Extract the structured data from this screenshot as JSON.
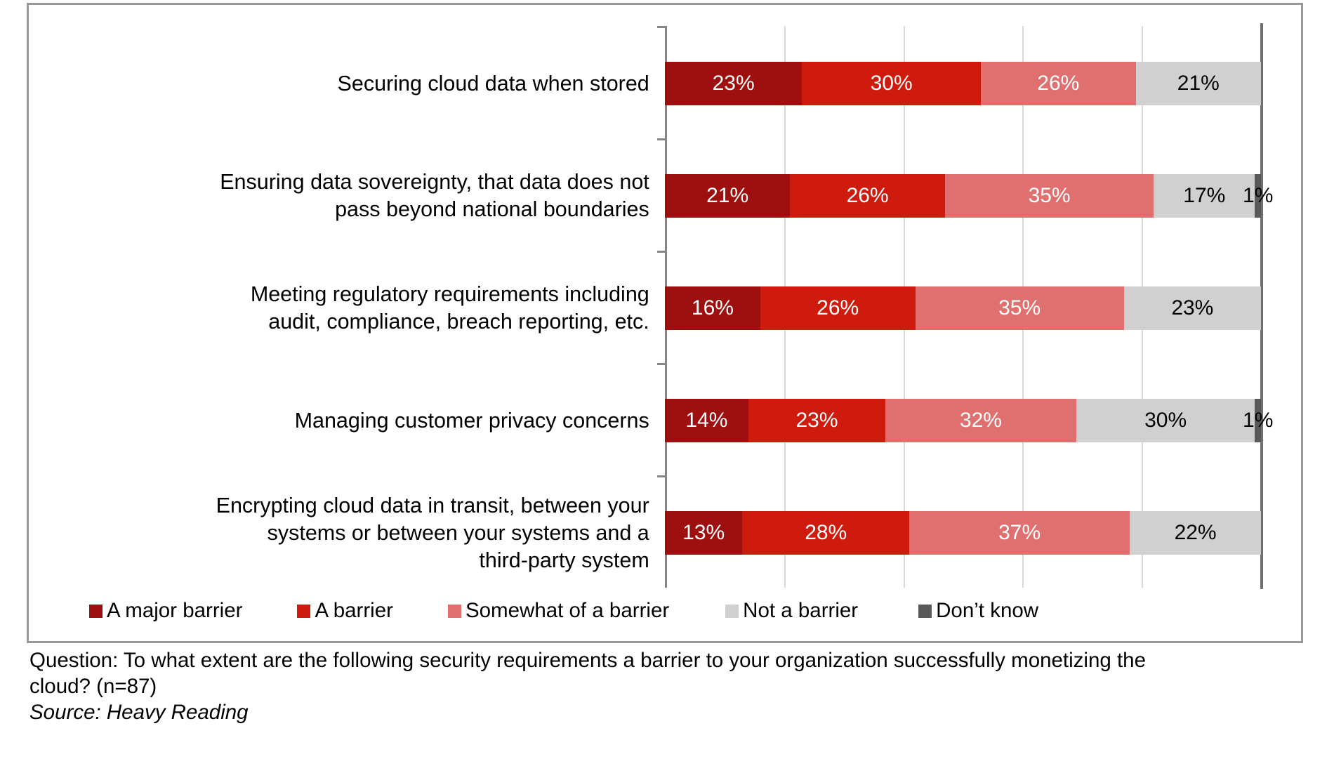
{
  "chart_data": {
    "type": "bar",
    "subtype": "100% stacked horizontal bar",
    "title": "",
    "xlabel": "",
    "ylabel": "",
    "xlim": [
      0,
      100
    ],
    "grid": true,
    "gridline_values": [
      0,
      20,
      40,
      60,
      80,
      100
    ],
    "legend_position": "bottom",
    "value_suffix": "%",
    "categories": [
      "Securing cloud data when stored",
      "Ensuring data sovereignty, that data does not\npass beyond national boundaries",
      "Meeting regulatory requirements including\naudit, compliance, breach reporting, etc.",
      "Managing customer privacy concerns",
      "Encrypting cloud data in transit, between your\nsystems or between your systems and a\nthird-party system"
    ],
    "series": [
      {
        "name": "A major barrier",
        "color": "#9E1010",
        "label_color": "#FFFFFF",
        "values": [
          23,
          21,
          16,
          14,
          13
        ],
        "labels": [
          "23%",
          "21%",
          "16%",
          "14%",
          "13%"
        ]
      },
      {
        "name": "A barrier",
        "color": "#CE1B0E",
        "label_color": "#FFFFFF",
        "values": [
          30,
          26,
          26,
          23,
          28
        ],
        "labels": [
          "30%",
          "26%",
          "26%",
          "23%",
          "28%"
        ]
      },
      {
        "name": "Somewhat of a barrier",
        "color": "#E07070",
        "label_color": "#FFFFFF",
        "values": [
          26,
          35,
          35,
          32,
          37
        ],
        "labels": [
          "26%",
          "35%",
          "35%",
          "32%",
          "37%"
        ]
      },
      {
        "name": "Not a barrier",
        "color": "#D0D0D0",
        "label_color": "#000000",
        "values": [
          21,
          17,
          23,
          30,
          22
        ],
        "labels": [
          "21%",
          "17%",
          "23%",
          "30%",
          "22%"
        ]
      },
      {
        "name": "Don’t know",
        "color": "#595959",
        "label_color": "#000000",
        "values": [
          0,
          1,
          0,
          1,
          0
        ],
        "labels": [
          "",
          "1%",
          "",
          "1%",
          ""
        ]
      }
    ]
  },
  "legend": {
    "items": [
      {
        "label": "A major barrier",
        "color": "#9E1010"
      },
      {
        "label": "A barrier",
        "color": "#CE1B0E"
      },
      {
        "label": "Somewhat of a barrier",
        "color": "#E07070"
      },
      {
        "label": "Not a barrier",
        "color": "#D0D0D0"
      },
      {
        "label": "Don’t know",
        "color": "#595959"
      }
    ]
  },
  "caption": {
    "question": "Question: To what extent are the following security requirements a barrier to your organization successfully monetizing the cloud? (n=87)",
    "source": "Source: Heavy Reading"
  }
}
